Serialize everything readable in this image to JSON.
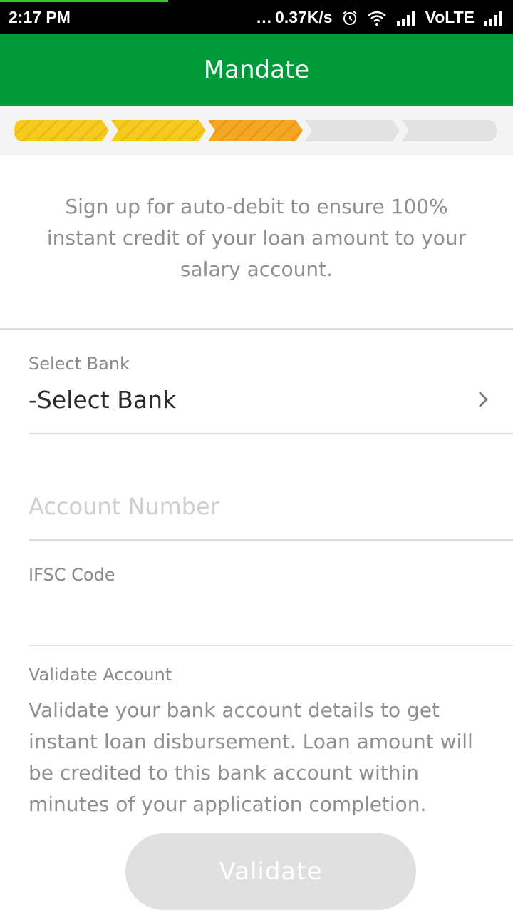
{
  "status_bar": {
    "time": "2:17 PM",
    "dots": "...",
    "net_speed": "0.37K/s",
    "network_label": "VoLTE",
    "icons": [
      "alarm-icon",
      "wifi-icon",
      "signal-icon",
      "signal-icon"
    ]
  },
  "header": {
    "title": "Mandate"
  },
  "stepper": {
    "total_steps": 5,
    "completed_steps": 2,
    "current_step": 3,
    "colors": {
      "completed": "#f6cb1e",
      "current": "#f5a623",
      "pending": "#e2e2e2"
    }
  },
  "intro": {
    "text": "Sign up for auto-debit to ensure 100% instant credit of your loan amount to your salary account."
  },
  "form": {
    "bank": {
      "label": "Select Bank",
      "value": "-Select Bank"
    },
    "account_number": {
      "placeholder": "Account Number",
      "value": ""
    },
    "ifsc": {
      "label": "IFSC Code",
      "value": ""
    },
    "validate": {
      "label": "Validate Account",
      "description": "Validate your bank account details to get instant loan disbursement. Loan amount will be credited to this bank account within minutes of your application completion.",
      "button_label": "Validate"
    }
  },
  "colors": {
    "brand": "#009a3a",
    "status_bar": "#000000",
    "button_disabled": "#e0e0e0"
  }
}
